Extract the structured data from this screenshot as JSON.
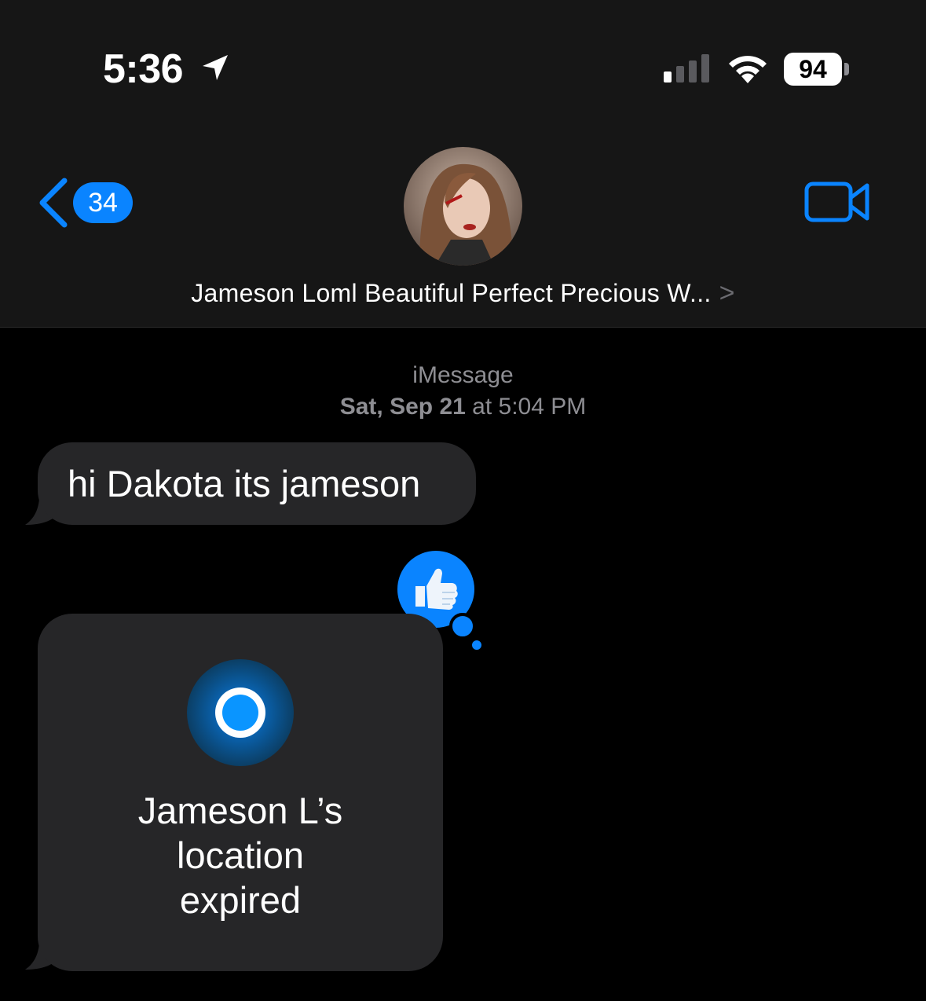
{
  "status_bar": {
    "time": "5:36",
    "battery": "94"
  },
  "nav": {
    "back_badge": "34",
    "contact_name": "Jameson Loml Beautiful Perfect Precious W...",
    "chevron": ">"
  },
  "thread": {
    "service": "iMessage",
    "date": "Sat, Sep 21",
    "at": "at",
    "time": "5:04 PM"
  },
  "messages": [
    {
      "sender": "incoming",
      "text": "hi Dakota its jameson",
      "reaction": "thumbs-up"
    },
    {
      "sender": "incoming",
      "type": "location",
      "text": "Jameson L’s location expired"
    }
  ],
  "colors": {
    "accent": "#0a84ff",
    "header_bg": "#161616",
    "bubble_incoming": "#262628",
    "secondary_text": "#8e8e93"
  }
}
